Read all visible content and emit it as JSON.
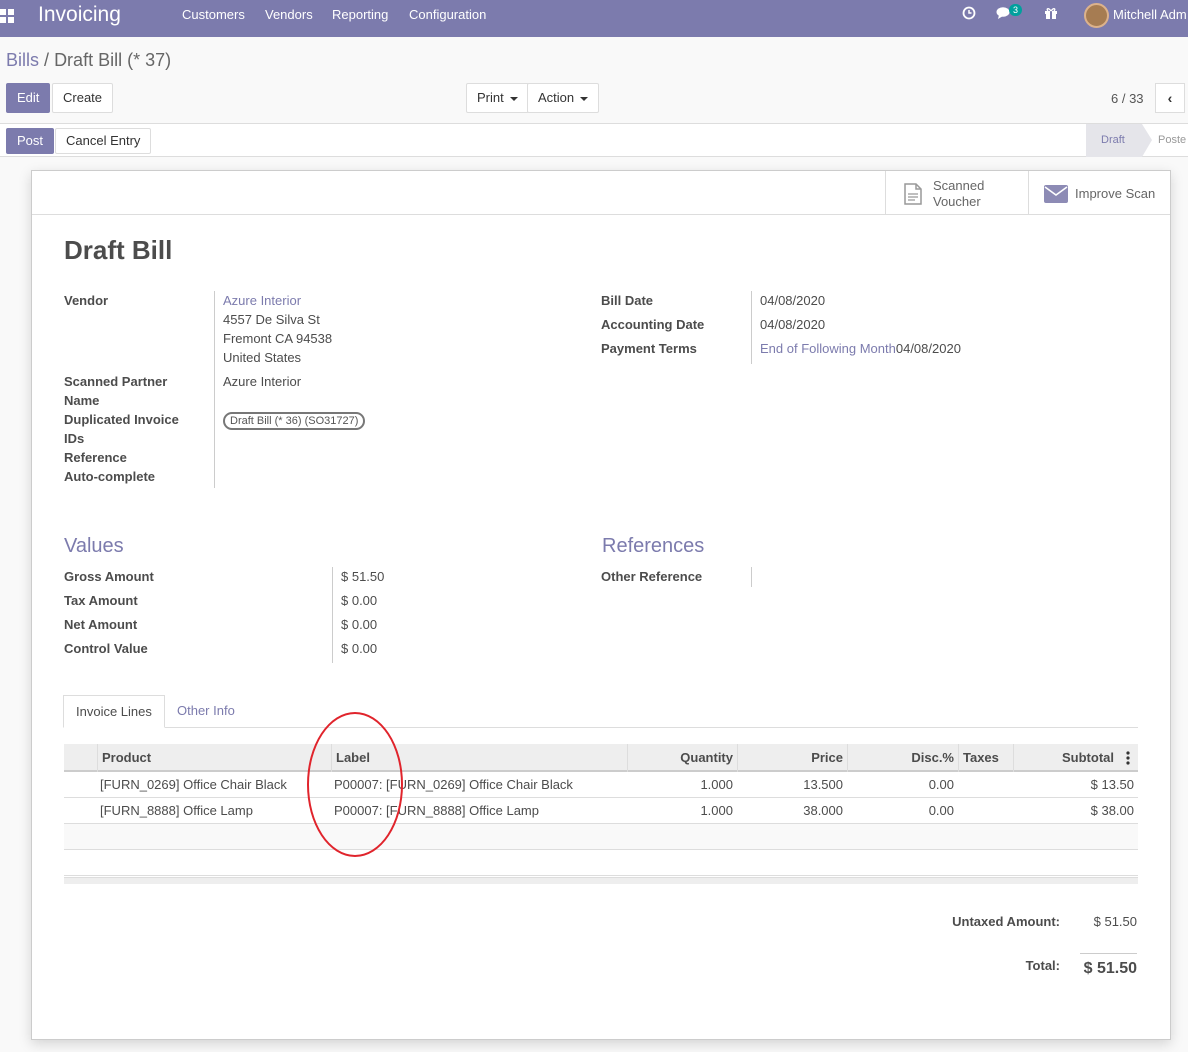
{
  "navbar": {
    "app_name": "Invoicing",
    "menus": [
      "Customers",
      "Vendors",
      "Reporting",
      "Configuration"
    ],
    "message_count": "3",
    "user_name": "Mitchell Adm"
  },
  "breadcrumb": {
    "parent": "Bills",
    "separator": "/",
    "current": "Draft Bill (* 37)"
  },
  "toolbar": {
    "edit": "Edit",
    "create": "Create",
    "print": "Print",
    "action": "Action",
    "pager": "6 / 33",
    "prev": "‹"
  },
  "statusbar": {
    "post": "Post",
    "cancel_entry": "Cancel Entry",
    "steps": [
      "Draft",
      "Poste"
    ]
  },
  "smart_buttons": {
    "scanned_voucher": [
      "Scanned",
      "Voucher"
    ],
    "improve_scan": "Improve Scan"
  },
  "form": {
    "title": "Draft Bill",
    "vendor_label": "Vendor",
    "vendor_name": "Azure Interior",
    "vendor_address": [
      "4557 De Silva St",
      "Fremont CA 94538",
      "United States"
    ],
    "scanned_partner_label": [
      "Scanned Partner",
      "Name"
    ],
    "scanned_partner_value": "Azure Interior",
    "duplicated_label": [
      "Duplicated Invoice",
      "IDs"
    ],
    "duplicated_tag": "Draft Bill (* 36) (SO31727)",
    "reference_label": "Reference",
    "autocomplete_label": "Auto-complete",
    "bill_date_label": "Bill Date",
    "bill_date": "04/08/2020",
    "accounting_date_label": "Accounting Date",
    "accounting_date": "04/08/2020",
    "payment_terms_label": "Payment Terms",
    "payment_terms": "End of Following Month",
    "payment_terms_date": "04/08/2020"
  },
  "values": {
    "title": "Values",
    "rows": [
      {
        "label": "Gross Amount",
        "value": "$ 51.50"
      },
      {
        "label": "Tax Amount",
        "value": "$ 0.00"
      },
      {
        "label": "Net Amount",
        "value": "$ 0.00"
      },
      {
        "label": "Control Value",
        "value": "$ 0.00"
      }
    ]
  },
  "references": {
    "title": "References",
    "other_reference_label": "Other Reference"
  },
  "tabs": [
    "Invoice Lines",
    "Other Info"
  ],
  "invoice_lines": {
    "headers": [
      "Product",
      "Label",
      "Quantity",
      "Price",
      "Disc.%",
      "Taxes",
      "Subtotal"
    ],
    "rows": [
      {
        "product": "[FURN_0269] Office Chair Black",
        "label": "P00007: [FURN_0269] Office Chair Black",
        "quantity": "1.000",
        "price": "13.500",
        "discount": "0.00",
        "taxes": "",
        "subtotal": "$ 13.50"
      },
      {
        "product": "[FURN_8888] Office Lamp",
        "label": "P00007: [FURN_8888] Office Lamp",
        "quantity": "1.000",
        "price": "38.000",
        "discount": "0.00",
        "taxes": "",
        "subtotal": "$ 38.00"
      }
    ]
  },
  "totals": {
    "untaxed_label": "Untaxed Amount:",
    "untaxed_value": "$ 51.50",
    "total_label": "Total:",
    "total_value": "$ 51.50"
  },
  "colors": {
    "brand": "#7c7bad",
    "annotation": "#e0242c"
  }
}
